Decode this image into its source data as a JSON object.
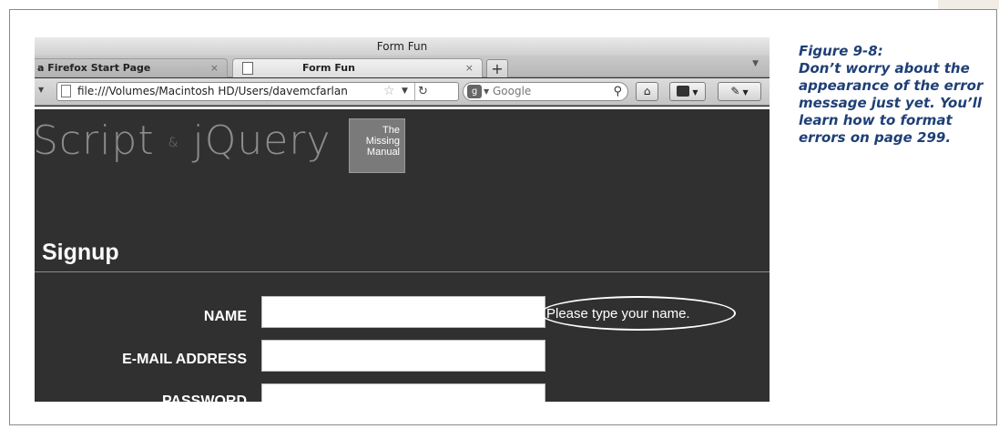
{
  "browser": {
    "window_title": "Form Fun",
    "tabs": [
      {
        "label": "a Firefox Start Page",
        "close": "×"
      },
      {
        "label": "Form Fun",
        "close": "×"
      }
    ],
    "new_tab": "+",
    "url": "file:///Volumes/Macintosh HD/Users/davemcfarlan",
    "search_placeholder": "Google"
  },
  "page": {
    "logo_text_a": "Script",
    "logo_amp": "&",
    "logo_text_b": "jQuery",
    "badge_lines": [
      "The",
      "Missing",
      "Manual"
    ],
    "section_title": "Signup",
    "form": {
      "name_label": "NAME",
      "email_label": "E-MAIL ADDRESS",
      "password_label": "PASSWORD",
      "name_error": "Please type your name."
    }
  },
  "caption": {
    "title": "Figure 9-8:",
    "text": "Don’t worry about the appearance of the error message just yet. You’ll learn how to format errors on page 299."
  },
  "colors": {
    "caption": "#1f3f76",
    "page_bg": "#303030"
  },
  "icons": [
    "page-icon",
    "star-icon",
    "reload-icon",
    "search-icon",
    "home-icon",
    "bookmarks-icon",
    "extension-icon"
  ]
}
